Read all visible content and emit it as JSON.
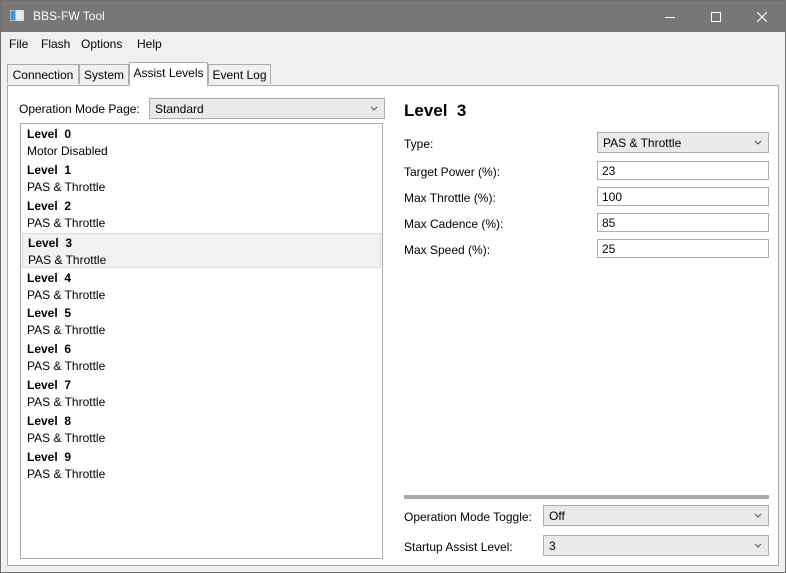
{
  "window": {
    "title": "BBS-FW Tool"
  },
  "menu": [
    {
      "label": "File"
    },
    {
      "label": "Flash"
    },
    {
      "label": "Options"
    },
    {
      "label": "Help"
    }
  ],
  "tabs": [
    {
      "label": "Connection",
      "active": false
    },
    {
      "label": "System",
      "active": false
    },
    {
      "label": "Assist Levels",
      "active": true
    },
    {
      "label": "Event Log",
      "active": false
    }
  ],
  "operation_mode_page": {
    "label": "Operation Mode Page:",
    "value": "Standard"
  },
  "levels": [
    {
      "title": "Level  0",
      "subtitle": "Motor Disabled"
    },
    {
      "title": "Level  1",
      "subtitle": "PAS & Throttle"
    },
    {
      "title": "Level  2",
      "subtitle": "PAS & Throttle"
    },
    {
      "title": "Level  3",
      "subtitle": "PAS & Throttle"
    },
    {
      "title": "Level  4",
      "subtitle": "PAS & Throttle"
    },
    {
      "title": "Level  5",
      "subtitle": "PAS & Throttle"
    },
    {
      "title": "Level  6",
      "subtitle": "PAS & Throttle"
    },
    {
      "title": "Level  7",
      "subtitle": "PAS & Throttle"
    },
    {
      "title": "Level  8",
      "subtitle": "PAS & Throttle"
    },
    {
      "title": "Level  9",
      "subtitle": "PAS & Throttle"
    }
  ],
  "selected_level_index": 3,
  "detail": {
    "heading": "Level  3",
    "type": {
      "label": "Type:",
      "value": "PAS & Throttle"
    },
    "target_power": {
      "label": "Target Power (%):",
      "value": "23"
    },
    "max_throttle": {
      "label": "Max Throttle (%):",
      "value": "100"
    },
    "max_cadence": {
      "label": "Max Cadence (%):",
      "value": "85"
    },
    "max_speed": {
      "label": "Max Speed (%):",
      "value": "25"
    }
  },
  "operation_mode_toggle": {
    "label": "Operation Mode Toggle:",
    "value": "Off"
  },
  "startup_assist_level": {
    "label": "Startup Assist Level:",
    "value": "3"
  },
  "colors": {
    "titlebar": "#777777",
    "selection": "#f2f2f2",
    "border": "#acacac"
  },
  "icons": {
    "app": "app-window-icon",
    "minimize": "minimize-icon",
    "maximize": "maximize-icon",
    "close": "close-icon",
    "dropdown": "chevron-down-icon"
  }
}
